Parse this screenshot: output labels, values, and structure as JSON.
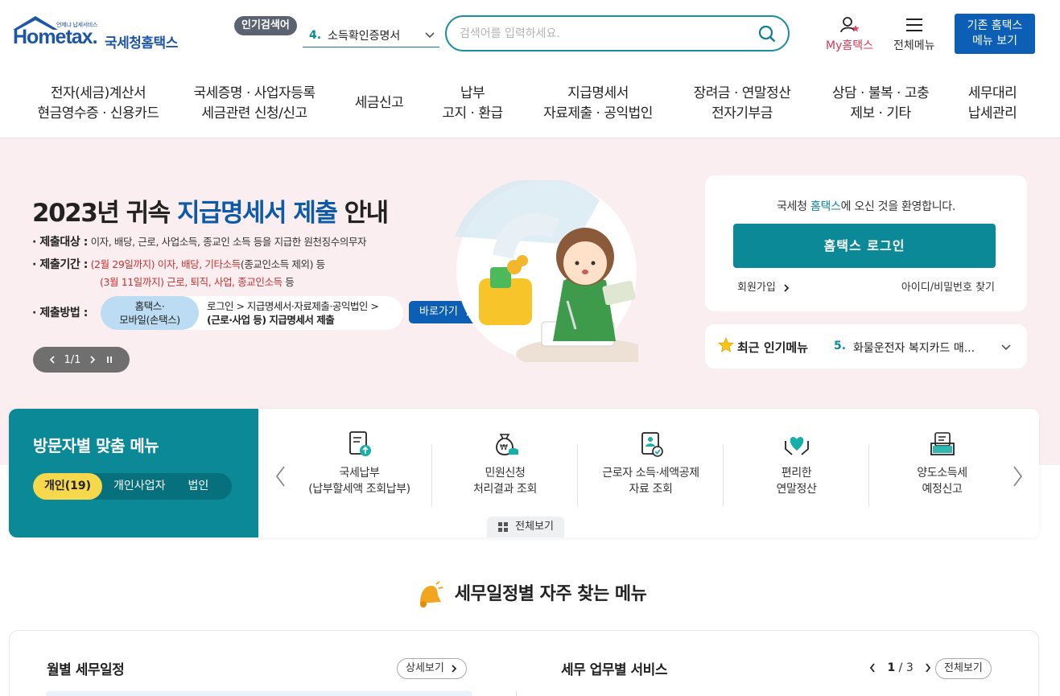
{
  "header": {
    "logo_tagline": "언제냐 납세서비스",
    "logo_brand": "Hometax.",
    "logo_sub": "국세청홈택스",
    "popular_tag": "인기검색어",
    "popular_num": "4.",
    "popular_text": "소득확인증명서",
    "search_placeholder": "검색어를 입력하세요.",
    "my_label": "My홈택스",
    "all_menu_label": "전체메뉴",
    "legacy_line1": "기존 홈택스",
    "legacy_line2": "메뉴 보기"
  },
  "gnb": [
    {
      "line1": "전자(세금)계산서",
      "line2": "현금영수증 · 신용카드"
    },
    {
      "line1": "국세증명 · 사업자등록",
      "line2": "세금관련 신청/신고"
    },
    {
      "line1": "세금신고",
      "line2": ""
    },
    {
      "line1": "납부",
      "line2": "고지 · 환급"
    },
    {
      "line1": "지급명세서",
      "line2": "자료제출 · 공익법인"
    },
    {
      "line1": "장려금 · 연말정산",
      "line2": "전자기부금"
    },
    {
      "line1": "상담 · 불복 · 고충",
      "line2": "제보 · 기타"
    },
    {
      "line1": "세무대리",
      "line2": "납세관리"
    }
  ],
  "hero": {
    "title_a": "2023년 귀속 ",
    "title_hl": "지급명세서 제출",
    "title_b": " 안내",
    "target_key": "· 제출대상 :",
    "target_val": "이자, 배당, 근로, 사업소득, 종교인 소득 등을 지급한 원천징수의무자",
    "period_key": "· 제출기간 :",
    "period_1_red": "(2월 29일까지) 이자, 배당, 기타소득",
    "period_1_rest": "(종교인소득 제외) 등",
    "period_2_red": "(3월 11일까지) 근로, 퇴직, 사업, 종교인소득",
    "period_2_rest": " 등",
    "method_key": "· 제출방법 :",
    "method_pill_1": "홈택스·",
    "method_pill_2": "모바일(손택스)",
    "method_path_1": "로그인 > 지급명세서·자료제출·공익법인 >",
    "method_path_2": "(근로·사업 등) 지급명세서 제출",
    "go_label": "바로가기",
    "slider_index": "1/1"
  },
  "login": {
    "welcome_a": "국세청 ",
    "welcome_teal": "홈택스",
    "welcome_b": "에 오신 것을 환영합니다.",
    "login_button": "홈택스 로그인",
    "join": "회원가입",
    "find": "아이디/비밀번호 찾기"
  },
  "recent": {
    "title": "최근 인기메뉴",
    "num": "5.",
    "item": "화물운전자 복지카드 매..."
  },
  "visitor": {
    "title": "방문자별 맞춤 메뉴",
    "tabs": [
      "개인(19)",
      "개인사업자",
      "법인"
    ],
    "items": [
      {
        "line1": "국세납부",
        "line2": "(납부할세액 조회납부)"
      },
      {
        "line1": "민원신청",
        "line2": "처리결과 조회"
      },
      {
        "line1": "근로자 소득·세액공제",
        "line2": "자료 조회"
      },
      {
        "line1": "편리한",
        "line2": "연말정산"
      },
      {
        "line1": "양도소득세",
        "line2": "예정신고"
      }
    ],
    "view_all": "전체보기"
  },
  "section": {
    "title": "세무일정별 자주 찾는 메뉴",
    "monthly_title": "월별 세무일정",
    "detail_btn": "상세보기",
    "service_title": "세무 업무별 서비스",
    "pager_current": "1",
    "pager_total": "/ 3",
    "view_all": "전체보기"
  },
  "colors": {
    "teal": "#0c8996",
    "blue": "#0c5fb5",
    "hero_bg": "#fbeef0",
    "accent_red": "#c9312f"
  }
}
